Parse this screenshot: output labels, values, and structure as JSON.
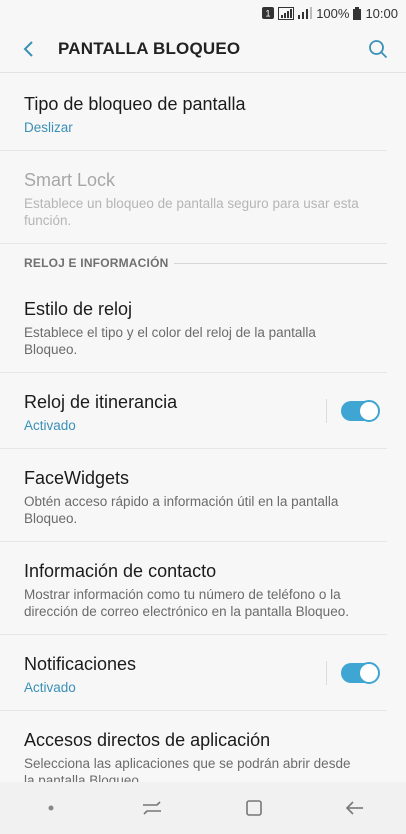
{
  "status_bar": {
    "sim_badge": "1",
    "battery": "100%",
    "time": "10:00"
  },
  "app_bar": {
    "title": "PANTALLA BLOQUEO"
  },
  "items": [
    {
      "title": "Tipo de bloqueo de pantalla",
      "subtitle": "Deslizar"
    },
    {
      "title": "Smart Lock",
      "subtitle": "Establece un bloqueo de pantalla seguro para usar esta función."
    },
    {
      "title": "Estilo de reloj",
      "subtitle": "Establece el tipo y el color del reloj de la pantalla Bloqueo."
    },
    {
      "title": "Reloj de itinerancia",
      "subtitle": "Activado",
      "toggle_on": true
    },
    {
      "title": "FaceWidgets",
      "subtitle": "Obtén acceso rápido a información útil en la pantalla Bloqueo."
    },
    {
      "title": "Información de contacto",
      "subtitle": "Mostrar información como tu número de teléfono o la dirección de correo electrónico en la pantalla Bloqueo."
    },
    {
      "title": "Notificaciones",
      "subtitle": "Activado",
      "toggle_on": true
    },
    {
      "title": "Accesos directos de aplicación",
      "subtitle": "Selecciona las aplicaciones que se podrán abrir desde la pantalla Bloqueo."
    }
  ],
  "section_header": "RELOJ E INFORMACIÓN",
  "colors": {
    "accent": "#3a90b7",
    "toggle": "#3fa5d2"
  }
}
